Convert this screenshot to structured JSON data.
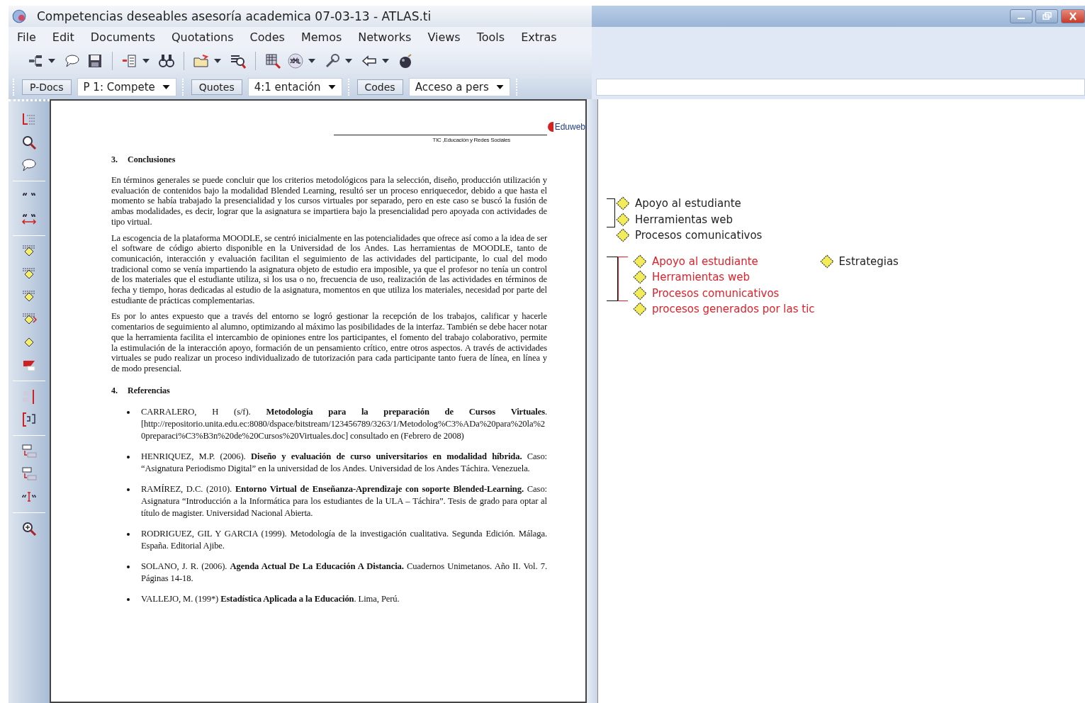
{
  "window": {
    "title": "Competencias deseables asesoría academica 07-03-13 - ATLAS.ti"
  },
  "menu": [
    "File",
    "Edit",
    "Documents",
    "Quotations",
    "Codes",
    "Memos",
    "Networks",
    "Views",
    "Tools",
    "Extras"
  ],
  "selectors": [
    {
      "button": "P-Docs",
      "dropdown": "P 1: Compete"
    },
    {
      "button": "Quotes",
      "dropdown": "4:1 entación"
    },
    {
      "button": "Codes",
      "dropdown": "Acceso a pers"
    }
  ],
  "document": {
    "logo": "Eduweb",
    "header": "TIC ,Educación y Redes Sociales",
    "sections": [
      {
        "number": "3.",
        "heading": "Conclusiones",
        "kind": "paragraphs",
        "items": [
          "En términos generales se puede concluir que los criterios metodológicos para la selección, diseño, producción utilización y evaluación de contenidos bajo la modalidad Blended Learning, resultó ser un proceso enriquecedor, debido a que hasta el momento se había trabajado la presencialidad y los cursos virtuales por separado, pero en este caso se buscó la fusión de ambas modalidades, es decir, lograr que la asignatura se impartiera bajo la presencialidad pero apoyada con actividades de tipo virtual.",
          "La escogencia de la plataforma MOODLE, se centró inicialmente en las potencialidades que ofrece así como a la idea de ser el software de código abierto disponible en la Universidad de los Andes. Las herramientas de MOODLE, tanto de comunicación, interacción y evaluación  facilitan el seguimiento de las actividades del participante, lo cual del modo tradicional como se venía impartiendo la asignatura objeto de estudio era imposible, ya que el profesor no tenía un control de los materiales que el estudiante utiliza, si los usa o no, frecuencia de uso, realización de las actividades en términos de fecha y tiempo, horas dedicadas al estudio de la asignatura, momentos en que utiliza los materiales, necesidad por parte del estudiante de prácticas complementarias.",
          "Es por lo antes expuesto que a través del entorno se logró gestionar la recepción de los trabajos, calificar y hacerle comentarios de seguimiento al alumno, optimizando al máximo las posibilidades de la interfaz. También se debe  hacer notar que la herramienta facilita el intercambio de opiniones entre los participantes, el fomento del trabajo colaborativo, permite la estimulación de la interacción apoyo, formación de un pensamiento crítico, entre otros aspectos.  A través de actividades virtuales se pudo realizar un proceso individualizado de tutorización para cada participante tanto fuera de línea, en línea y de modo presencial."
        ]
      },
      {
        "number": "4.",
        "heading": "Referencias",
        "kind": "bullets",
        "items": [
          "CARRALERO, H (s/f). **Metodología para la preparación de Cursos Virtuales**. [http://repositorio.unita.edu.ec:8080/dspace/bitstream/123456789/3263/1/Metodolog%C3%ADa%20para%20la%20preparaci%C3%B3n%20de%20Cursos%20Virtuales.doc] consultado en (Febrero de 2008)",
          "HENRIQUEZ, M.P. (2006). **Diseño y evaluación de curso universitarios en modalidad híbrida.** Caso: “Asignatura Periodismo Digital” en la universidad de los Andes. Universidad de los Andes Táchira. Venezuela.",
          "RAMÍREZ, D.C. (2010). **Entorno Virtual de Enseñanza-Aprendizaje con soporte Blended-Learning.** Caso: Asignatura “Introducción a la Informática para los estudiantes de la ULA – Táchira”. Tesis de grado para optar al título de magister. Universidad Nacional Abierta.",
          "RODRIGUEZ, GIL Y GARCIA (1999). Metodología de la investigación cualitativa. Segunda Edición. Málaga. España. Editorial Ajibe.",
          "SOLANO, J. R. (2006). **Agenda Actual De La Educación A Distancia.**  Cuadernos Unimetanos. Año II. Vol. 7. Páginas 14-18.",
          "VALLEJO, M. (199*) **Estadística Aplicada a la Educación**. Lima, Perú."
        ]
      }
    ]
  },
  "network": {
    "groups": [
      {
        "kind": "single",
        "items": [
          {
            "label": "Apoyo al estudiante",
            "color": "#1e1e1e",
            "linked": true
          },
          {
            "label": "Herramientas web",
            "color": "#1e1e1e",
            "linked": true
          },
          {
            "label": "Procesos comunicativos",
            "color": "#1e1e1e",
            "linked": false
          }
        ]
      },
      {
        "kind": "double",
        "items": [
          {
            "label": "Apoyo al estudiante",
            "color": "#e0202a",
            "linked": true
          },
          {
            "label": "Herramientas web",
            "color": "#e0202a",
            "linked": true
          },
          {
            "label": "Procesos comunicativos",
            "color": "#e0202a",
            "linked": true
          },
          {
            "label": "procesos generados por las tic",
            "color": "#e0202a",
            "linked": false
          }
        ]
      }
    ],
    "side_node": {
      "label": "Estrategias",
      "color": "#1e1e1e"
    }
  }
}
